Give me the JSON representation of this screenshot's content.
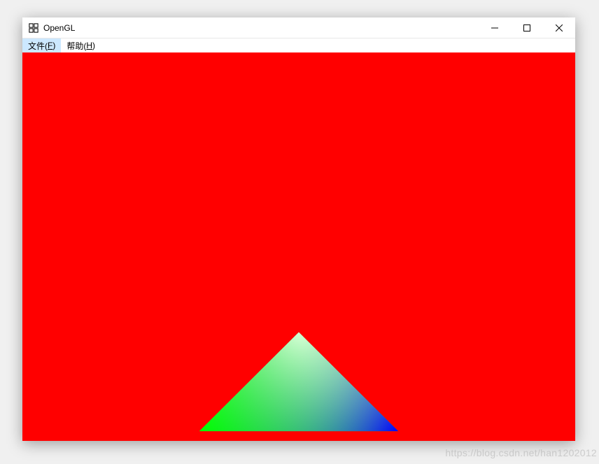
{
  "window": {
    "title": "OpenGL",
    "icon_name": "app-icon"
  },
  "menu": {
    "file": {
      "label_prefix": "文件(",
      "mnemonic": "F",
      "label_suffix": ")"
    },
    "help": {
      "label_prefix": "帮助(",
      "mnemonic": "H",
      "label_suffix": ")"
    }
  },
  "canvas": {
    "background_color": "#ff0000",
    "triangle": {
      "vertices": [
        {
          "x": 0.5,
          "y_from_bottom": 0.28,
          "color": "#ffffff"
        },
        {
          "x": 0.32,
          "y_from_bottom": 0.025,
          "color": "#00ff00"
        },
        {
          "x": 0.68,
          "y_from_bottom": 0.025,
          "color": "#0000ff"
        }
      ]
    }
  },
  "watermark": "https://blog.csdn.net/han1202012"
}
